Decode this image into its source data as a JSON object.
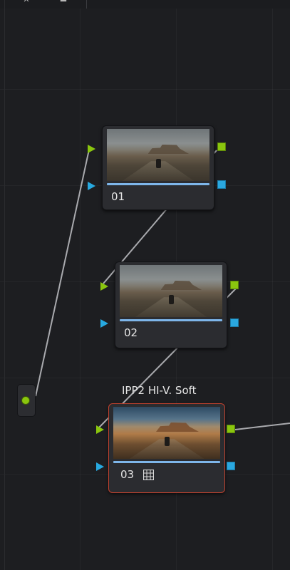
{
  "toolbar": {
    "icons": [
      "wand-icon",
      "eraser-icon"
    ]
  },
  "nodes": [
    {
      "label": "01"
    },
    {
      "label": "02"
    },
    {
      "label": "03",
      "title": "IPP2 HI-V. Soft",
      "icon": "lut-grid-icon",
      "selected": true
    }
  ],
  "colors": {
    "rgb_port": "#8ac60e",
    "alpha_port": "#27a9e0",
    "selected_border": "#c1422f",
    "bar": "#7eb6ea"
  }
}
